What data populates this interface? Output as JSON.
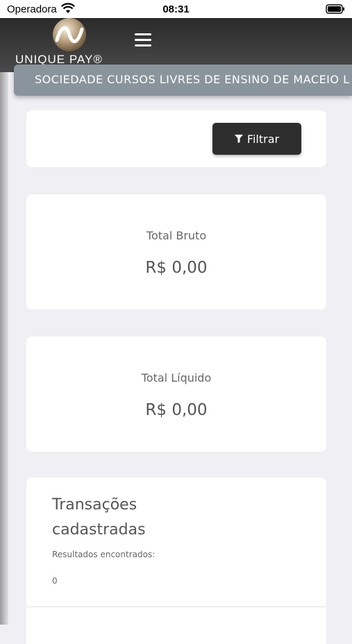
{
  "status_bar": {
    "carrier": "Operadora",
    "time": "08:31"
  },
  "brand": {
    "logo_text": "UNIQUE PAY®"
  },
  "company": {
    "name": "SOCIEDADE CURSOS LIVRES DE ENSINO DE MACEIO L"
  },
  "filter": {
    "button_label": "Filtrar",
    "icon": "filter-icon"
  },
  "totals": {
    "gross": {
      "label": "Total Bruto",
      "value": "R$ 0,00"
    },
    "net": {
      "label": "Total Líquido",
      "value": "R$ 0,00"
    }
  },
  "transactions": {
    "title": "Transações cadastradas",
    "results_label": "Resultados encontrados:",
    "count": "0"
  },
  "colors": {
    "header_dark": "#333333",
    "banner": "#8a949c",
    "button": "#2e2e2e",
    "background": "#efeff4"
  }
}
